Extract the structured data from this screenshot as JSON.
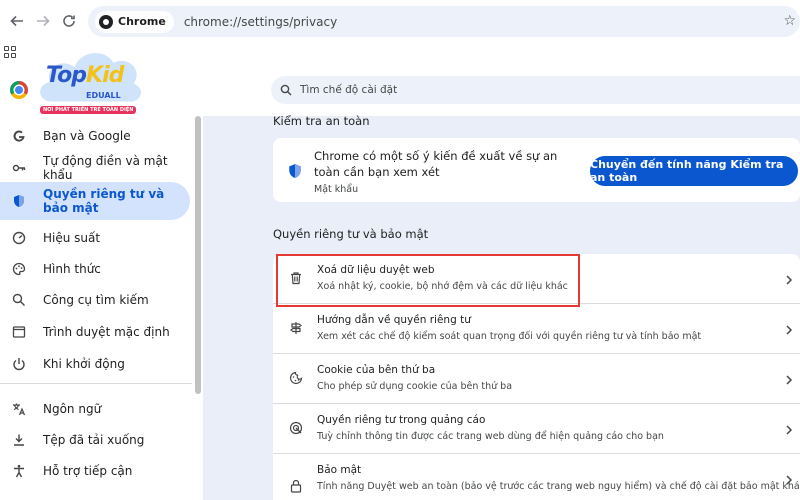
{
  "browser": {
    "site_chip": "Chrome",
    "url": "chrome://settings/privacy"
  },
  "logo": {
    "brand_top": "Top",
    "brand_kid": "Kid",
    "brand_sub": "EDUALL",
    "tagline": "NƠI PHÁT TRIỂN TRẺ TOÀN DIỆN"
  },
  "search": {
    "placeholder": "Tìm chế độ cài đặt"
  },
  "sidebar": {
    "items": [
      {
        "label": "Bạn và Google",
        "icon": "google-icon"
      },
      {
        "label": "Tự động điền và mật khẩu",
        "icon": "key-icon"
      },
      {
        "label": "Quyền riêng tư và bảo mật",
        "icon": "shield-icon"
      },
      {
        "label": "Hiệu suất",
        "icon": "speedometer-icon"
      },
      {
        "label": "Hình thức",
        "icon": "palette-icon"
      },
      {
        "label": "Công cụ tìm kiếm",
        "icon": "search-icon"
      },
      {
        "label": "Trình duyệt mặc định",
        "icon": "browser-window-icon"
      },
      {
        "label": "Khi khởi động",
        "icon": "power-icon"
      },
      {
        "label": "Ngôn ngữ",
        "icon": "translate-icon"
      },
      {
        "label": "Tệp đã tải xuống",
        "icon": "download-icon"
      },
      {
        "label": "Hỗ trợ tiếp cận",
        "icon": "accessibility-icon"
      }
    ]
  },
  "safety_check": {
    "section_title": "Kiểm tra an toàn",
    "message": "Chrome có một số ý kiến đề xuất về sự an toàn cần bạn xem xét",
    "detail": "Mật khẩu",
    "button_label": "Chuyển đến tính năng Kiểm tra an toàn"
  },
  "privacy": {
    "section_title": "Quyền riêng tư và bảo mật",
    "rows": [
      {
        "title": "Xoá dữ liệu duyệt web",
        "subtitle": "Xoá nhật ký, cookie, bộ nhớ đệm và các dữ liệu khác",
        "icon": "trash-icon"
      },
      {
        "title": "Hướng dẫn về quyền riêng tư",
        "subtitle": "Xem xét các chế độ kiểm soát quan trọng đối với quyền riêng tư và tính bảo mật",
        "icon": "signpost-icon"
      },
      {
        "title": "Cookie của bên thứ ba",
        "subtitle": "Cho phép sử dụng cookie của bên thứ ba",
        "icon": "cookie-icon"
      },
      {
        "title": "Quyền riêng tư trong quảng cáo",
        "subtitle": "Tuỳ chỉnh thông tin được các trang web dùng để hiện quảng cáo cho bạn",
        "icon": "ads-target-icon"
      },
      {
        "title": "Bảo mật",
        "subtitle": "Tính năng Duyệt web an toàn (bảo vệ trước các trang web nguy hiểm) và chế độ cài đặt bảo mật khác",
        "icon": "lock-icon"
      }
    ]
  },
  "colors": {
    "accent": "#0b57d0",
    "active_bg": "#d3e3fd",
    "page_bg": "#e9eef8",
    "highlight_box": "#e53935"
  }
}
